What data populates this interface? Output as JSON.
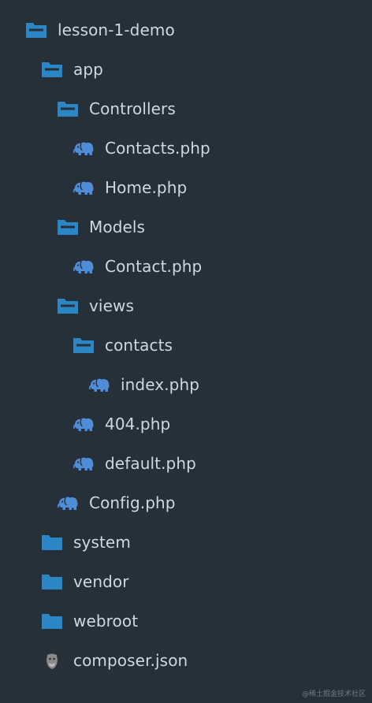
{
  "colors": {
    "background": "#263039",
    "text": "#cfd8e0",
    "folder_icon": "#2b86c5",
    "php_icon": "#4f8dd8",
    "json_icon": "#8a8a8a"
  },
  "tree": [
    {
      "label": "lesson-1-demo",
      "icon": "folder-open-icon"
    },
    {
      "label": "app",
      "icon": "folder-open-icon"
    },
    {
      "label": "Controllers",
      "icon": "folder-open-icon"
    },
    {
      "label": "Contacts.php",
      "icon": "php-elephant-icon"
    },
    {
      "label": "Home.php",
      "icon": "php-elephant-icon"
    },
    {
      "label": "Models",
      "icon": "folder-open-icon"
    },
    {
      "label": "Contact.php",
      "icon": "php-elephant-icon"
    },
    {
      "label": "views",
      "icon": "folder-open-icon"
    },
    {
      "label": "contacts",
      "icon": "folder-open-icon"
    },
    {
      "label": "index.php",
      "icon": "php-elephant-icon"
    },
    {
      "label": "404.php",
      "icon": "php-elephant-icon"
    },
    {
      "label": "default.php",
      "icon": "php-elephant-icon"
    },
    {
      "label": "Config.php",
      "icon": "php-elephant-icon"
    },
    {
      "label": "system",
      "icon": "folder-closed-icon"
    },
    {
      "label": "vendor",
      "icon": "folder-closed-icon"
    },
    {
      "label": "webroot",
      "icon": "folder-closed-icon"
    },
    {
      "label": "composer.json",
      "icon": "composer-json-icon"
    }
  ],
  "watermark": "@稀土掘金技术社区"
}
